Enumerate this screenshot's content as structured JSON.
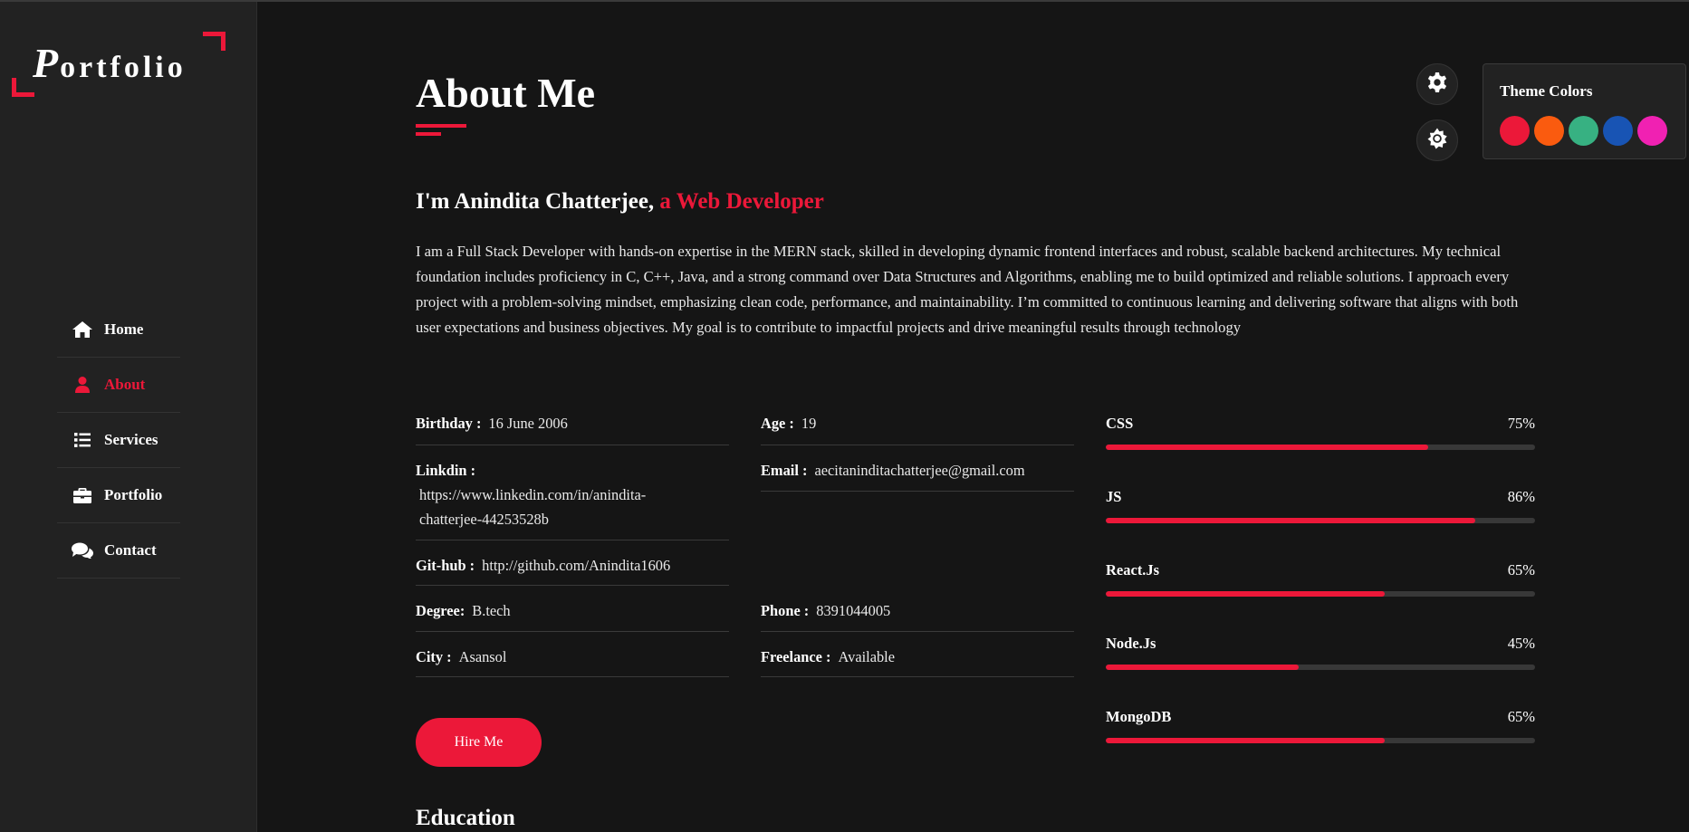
{
  "sidebar": {
    "logo": {
      "initial": "P",
      "rest": "ortfolio"
    },
    "nav": [
      {
        "label": "Home",
        "icon": "home-icon"
      },
      {
        "label": "About",
        "icon": "user-icon",
        "active": true
      },
      {
        "label": "Services",
        "icon": "list-icon"
      },
      {
        "label": "Portfolio",
        "icon": "briefcase-icon"
      },
      {
        "label": "Contact",
        "icon": "comments-icon"
      }
    ]
  },
  "main": {
    "title": "About Me",
    "intro": {
      "name": "I'm Anindita Chatterjee,",
      "role": "a Web Developer"
    },
    "description": "I am a Full Stack Developer with hands-on expertise in the MERN stack, skilled in developing dynamic frontend interfaces and robust, scalable backend architectures. My technical foundation includes proficiency in C, C++, Java, and a strong command over Data Structures and Algorithms, enabling me to build optimized and reliable solutions. I approach every project with a problem-solving mindset, emphasizing clean code, performance, and maintainability. I’m committed to continuous learning and delivering software that aligns with both user expectations and business objectives. My goal is to contribute to impactful projects and drive meaningful results through technology",
    "info_left": {
      "birthday": {
        "label": "Birthday :",
        "value": "16 June 2006"
      },
      "linkedin": {
        "label": "Linkdin :",
        "value": "https://www.linkedin.com/in/anindita-chatterjee-44253528b"
      },
      "github": {
        "label": "Git-hub :",
        "value": "http://github.com/Anindita1606"
      },
      "degree": {
        "label": "Degree:",
        "value": "B.tech"
      },
      "city": {
        "label": "City :",
        "value": "Asansol"
      }
    },
    "info_right": {
      "age": {
        "label": "Age :",
        "value": "19"
      },
      "email": {
        "label": "Email :",
        "value": "aecitaninditachatterjee@gmail.com"
      },
      "phone": {
        "label": "Phone :",
        "value": "8391044005"
      },
      "freelance": {
        "label": "Freelance :",
        "value": "Available"
      }
    },
    "skills": [
      {
        "name": "CSS",
        "percent_label": "75%",
        "percent": 75
      },
      {
        "name": "JS",
        "percent_label": "86%",
        "percent": 86
      },
      {
        "name": "React.Js",
        "percent_label": "65%",
        "percent": 65
      },
      {
        "name": "Node.Js",
        "percent_label": "45%",
        "percent": 45
      },
      {
        "name": "MongoDB",
        "percent_label": "65%",
        "percent": 65
      }
    ],
    "hire_button": "Hire Me",
    "education_heading": "Education"
  },
  "theme": {
    "title": "Theme Colors",
    "settings_icon": "gear-icon",
    "mode_icon": "sun-icon",
    "swatches": [
      "#ec1839",
      "#fa5b0f",
      "#37b182",
      "#1854b4",
      "#f021b2"
    ]
  },
  "colors": {
    "accent": "#ec1839",
    "background": "#151515",
    "sidebar": "#222222"
  }
}
